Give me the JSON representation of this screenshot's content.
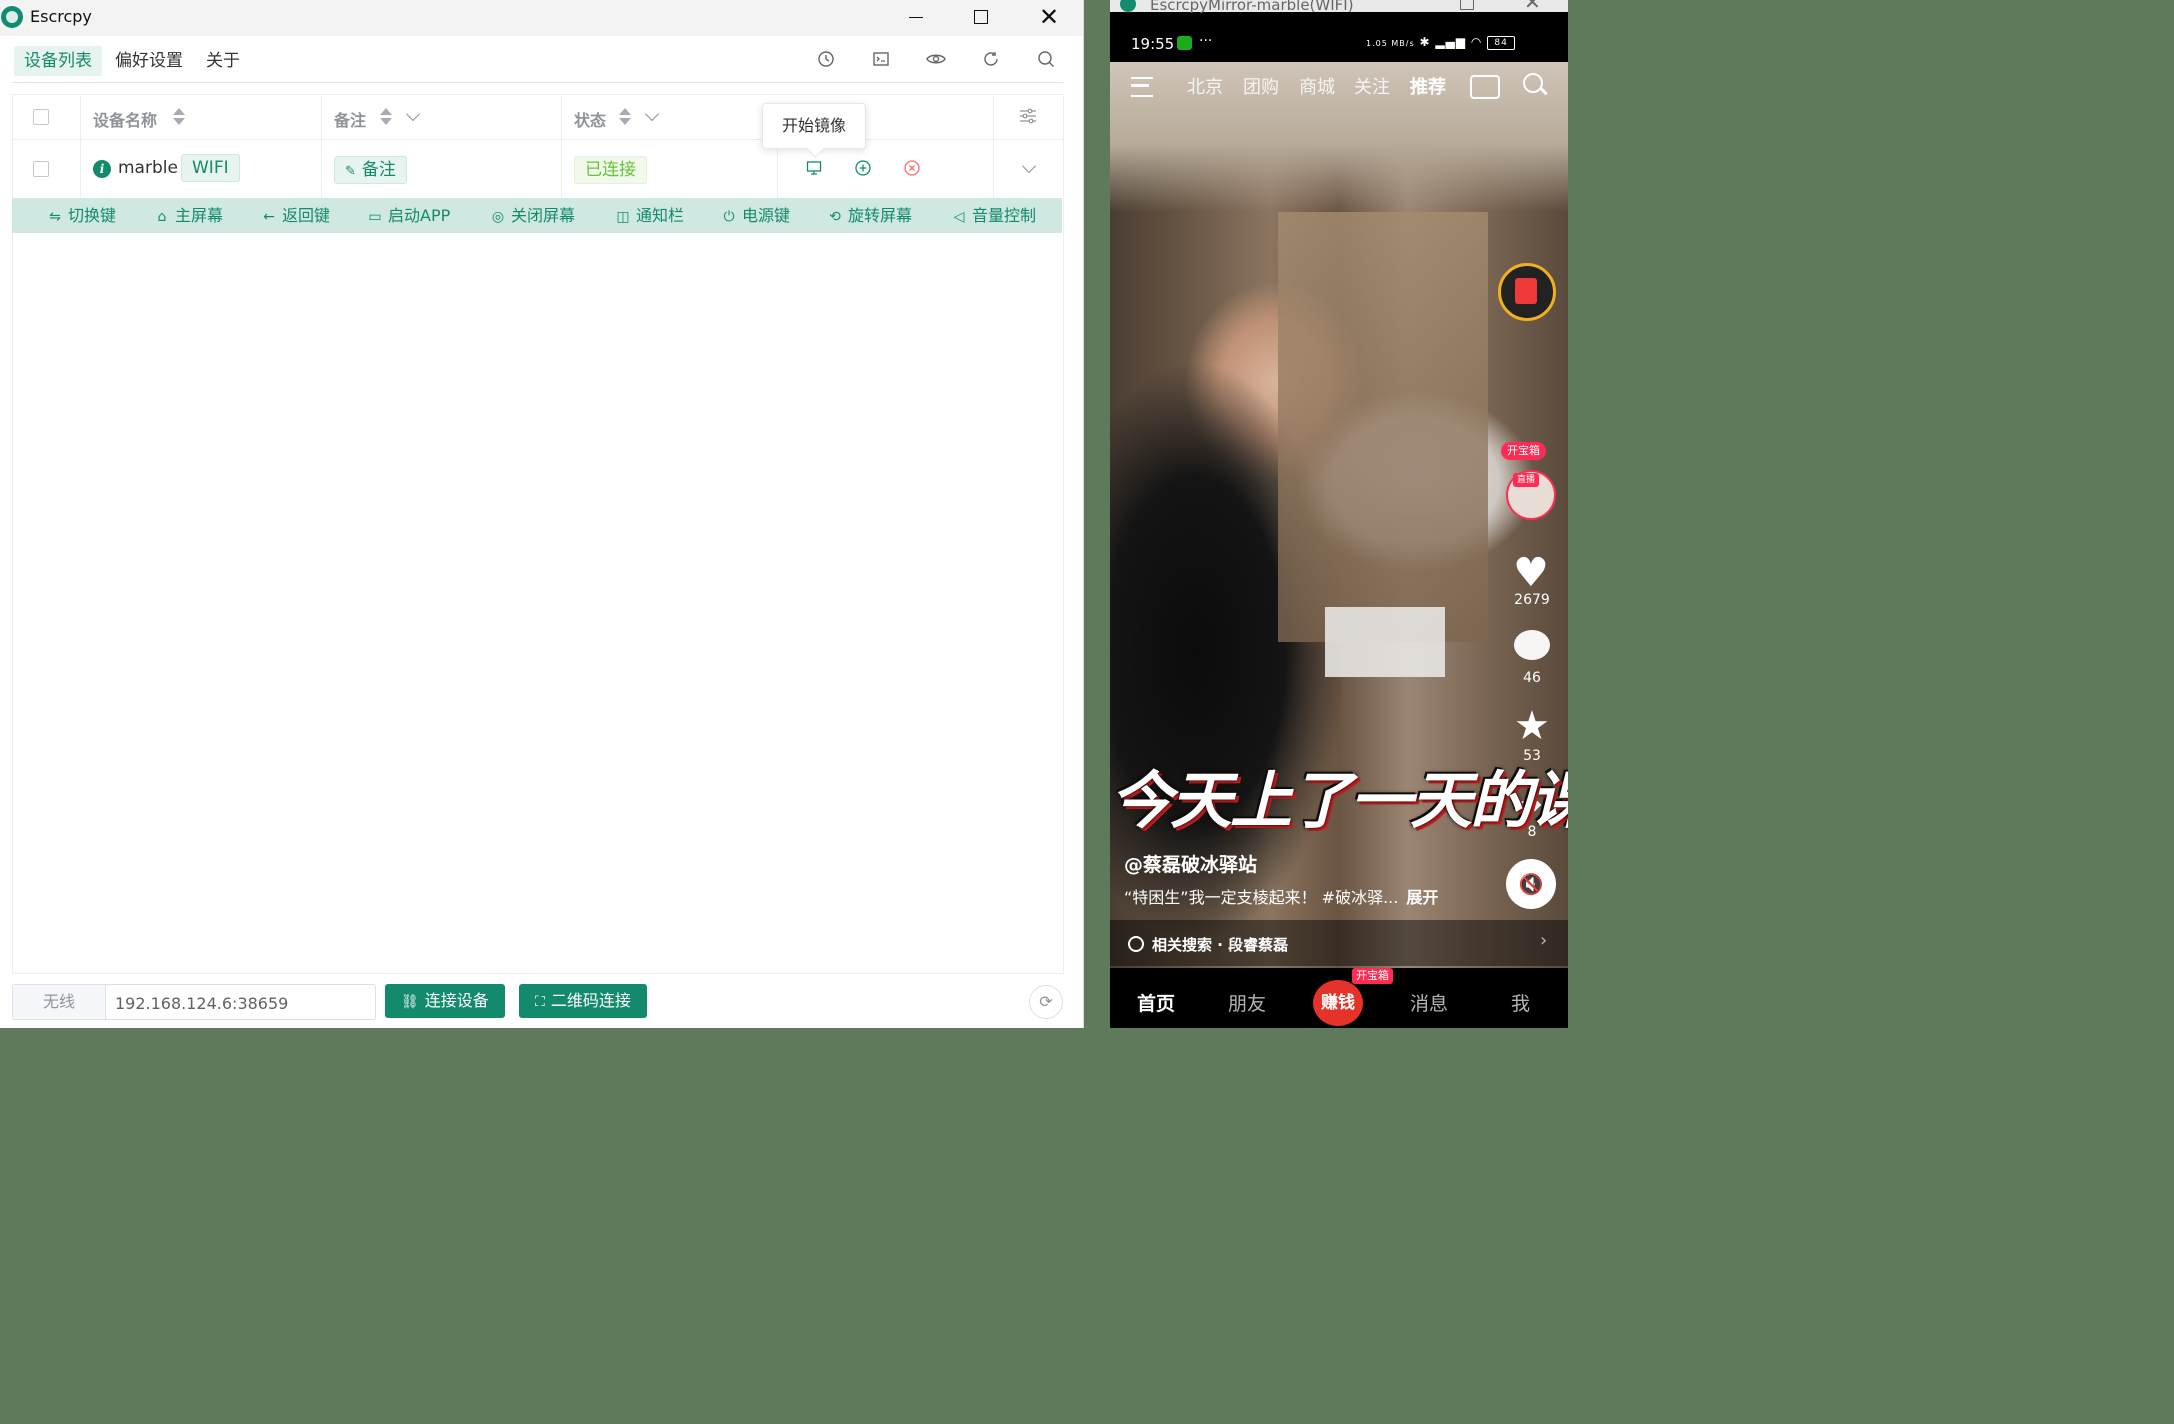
{
  "window": {
    "title": "Escrcpy"
  },
  "nav": {
    "tabs": [
      {
        "label": "设备列表"
      },
      {
        "label": "偏好设置"
      },
      {
        "label": "关于"
      }
    ]
  },
  "table": {
    "columns": {
      "name": "设备名称",
      "remark": "备注",
      "status": "状态"
    },
    "rows": [
      {
        "name": "marble",
        "connection": "WIFI",
        "remark": "备注",
        "status": "已连接"
      }
    ],
    "tooltip": "开始镜像",
    "controls": [
      {
        "icon": "switch-icon",
        "label": "切换键"
      },
      {
        "icon": "home-icon",
        "label": "主屏幕"
      },
      {
        "icon": "back-arrow-icon",
        "label": "返回键"
      },
      {
        "icon": "app-launch-icon",
        "label": "启动APP"
      },
      {
        "icon": "screen-off-toggle-icon",
        "label": "关闭屏幕"
      },
      {
        "icon": "notification-icon",
        "label": "通知栏"
      },
      {
        "icon": "power-icon",
        "label": "电源键"
      },
      {
        "icon": "rotate-icon",
        "label": "旋转屏幕"
      },
      {
        "icon": "volume-icon",
        "label": "音量控制"
      }
    ]
  },
  "footer": {
    "prefix": "无线",
    "address": "192.168.124.6:38659",
    "connect_label": "连接设备",
    "qr_label": "二维码连接"
  },
  "colors": {
    "accent": "#148a6c",
    "accent_light": "#cfe8e1",
    "danger": "#f56c6c",
    "success": "#67c23a"
  },
  "mirror": {
    "title": "EscrcpyMirror-marble(WIFI)",
    "status_time": "19:55",
    "status_dots": "···",
    "net_speed": "1.05 MB/s",
    "battery": "84",
    "top_nav": [
      "北京",
      "团购",
      "商城",
      "关注",
      "推荐"
    ],
    "treasure": "开宝箱",
    "live": "直播",
    "likes": "2679",
    "comments": "46",
    "favorites": "53",
    "shares": "8",
    "caption": "今天上了一天的课",
    "author": "@蔡磊破冰驿站",
    "description": "“特困生”我一定支棱起来！ #破冰驿...",
    "expand": "展开",
    "related": "相关搜索 · 段睿蔡磊",
    "tabs": [
      "首页",
      "朋友",
      "赚钱",
      "消息",
      "我"
    ],
    "earn_tag": "开宝箱"
  }
}
